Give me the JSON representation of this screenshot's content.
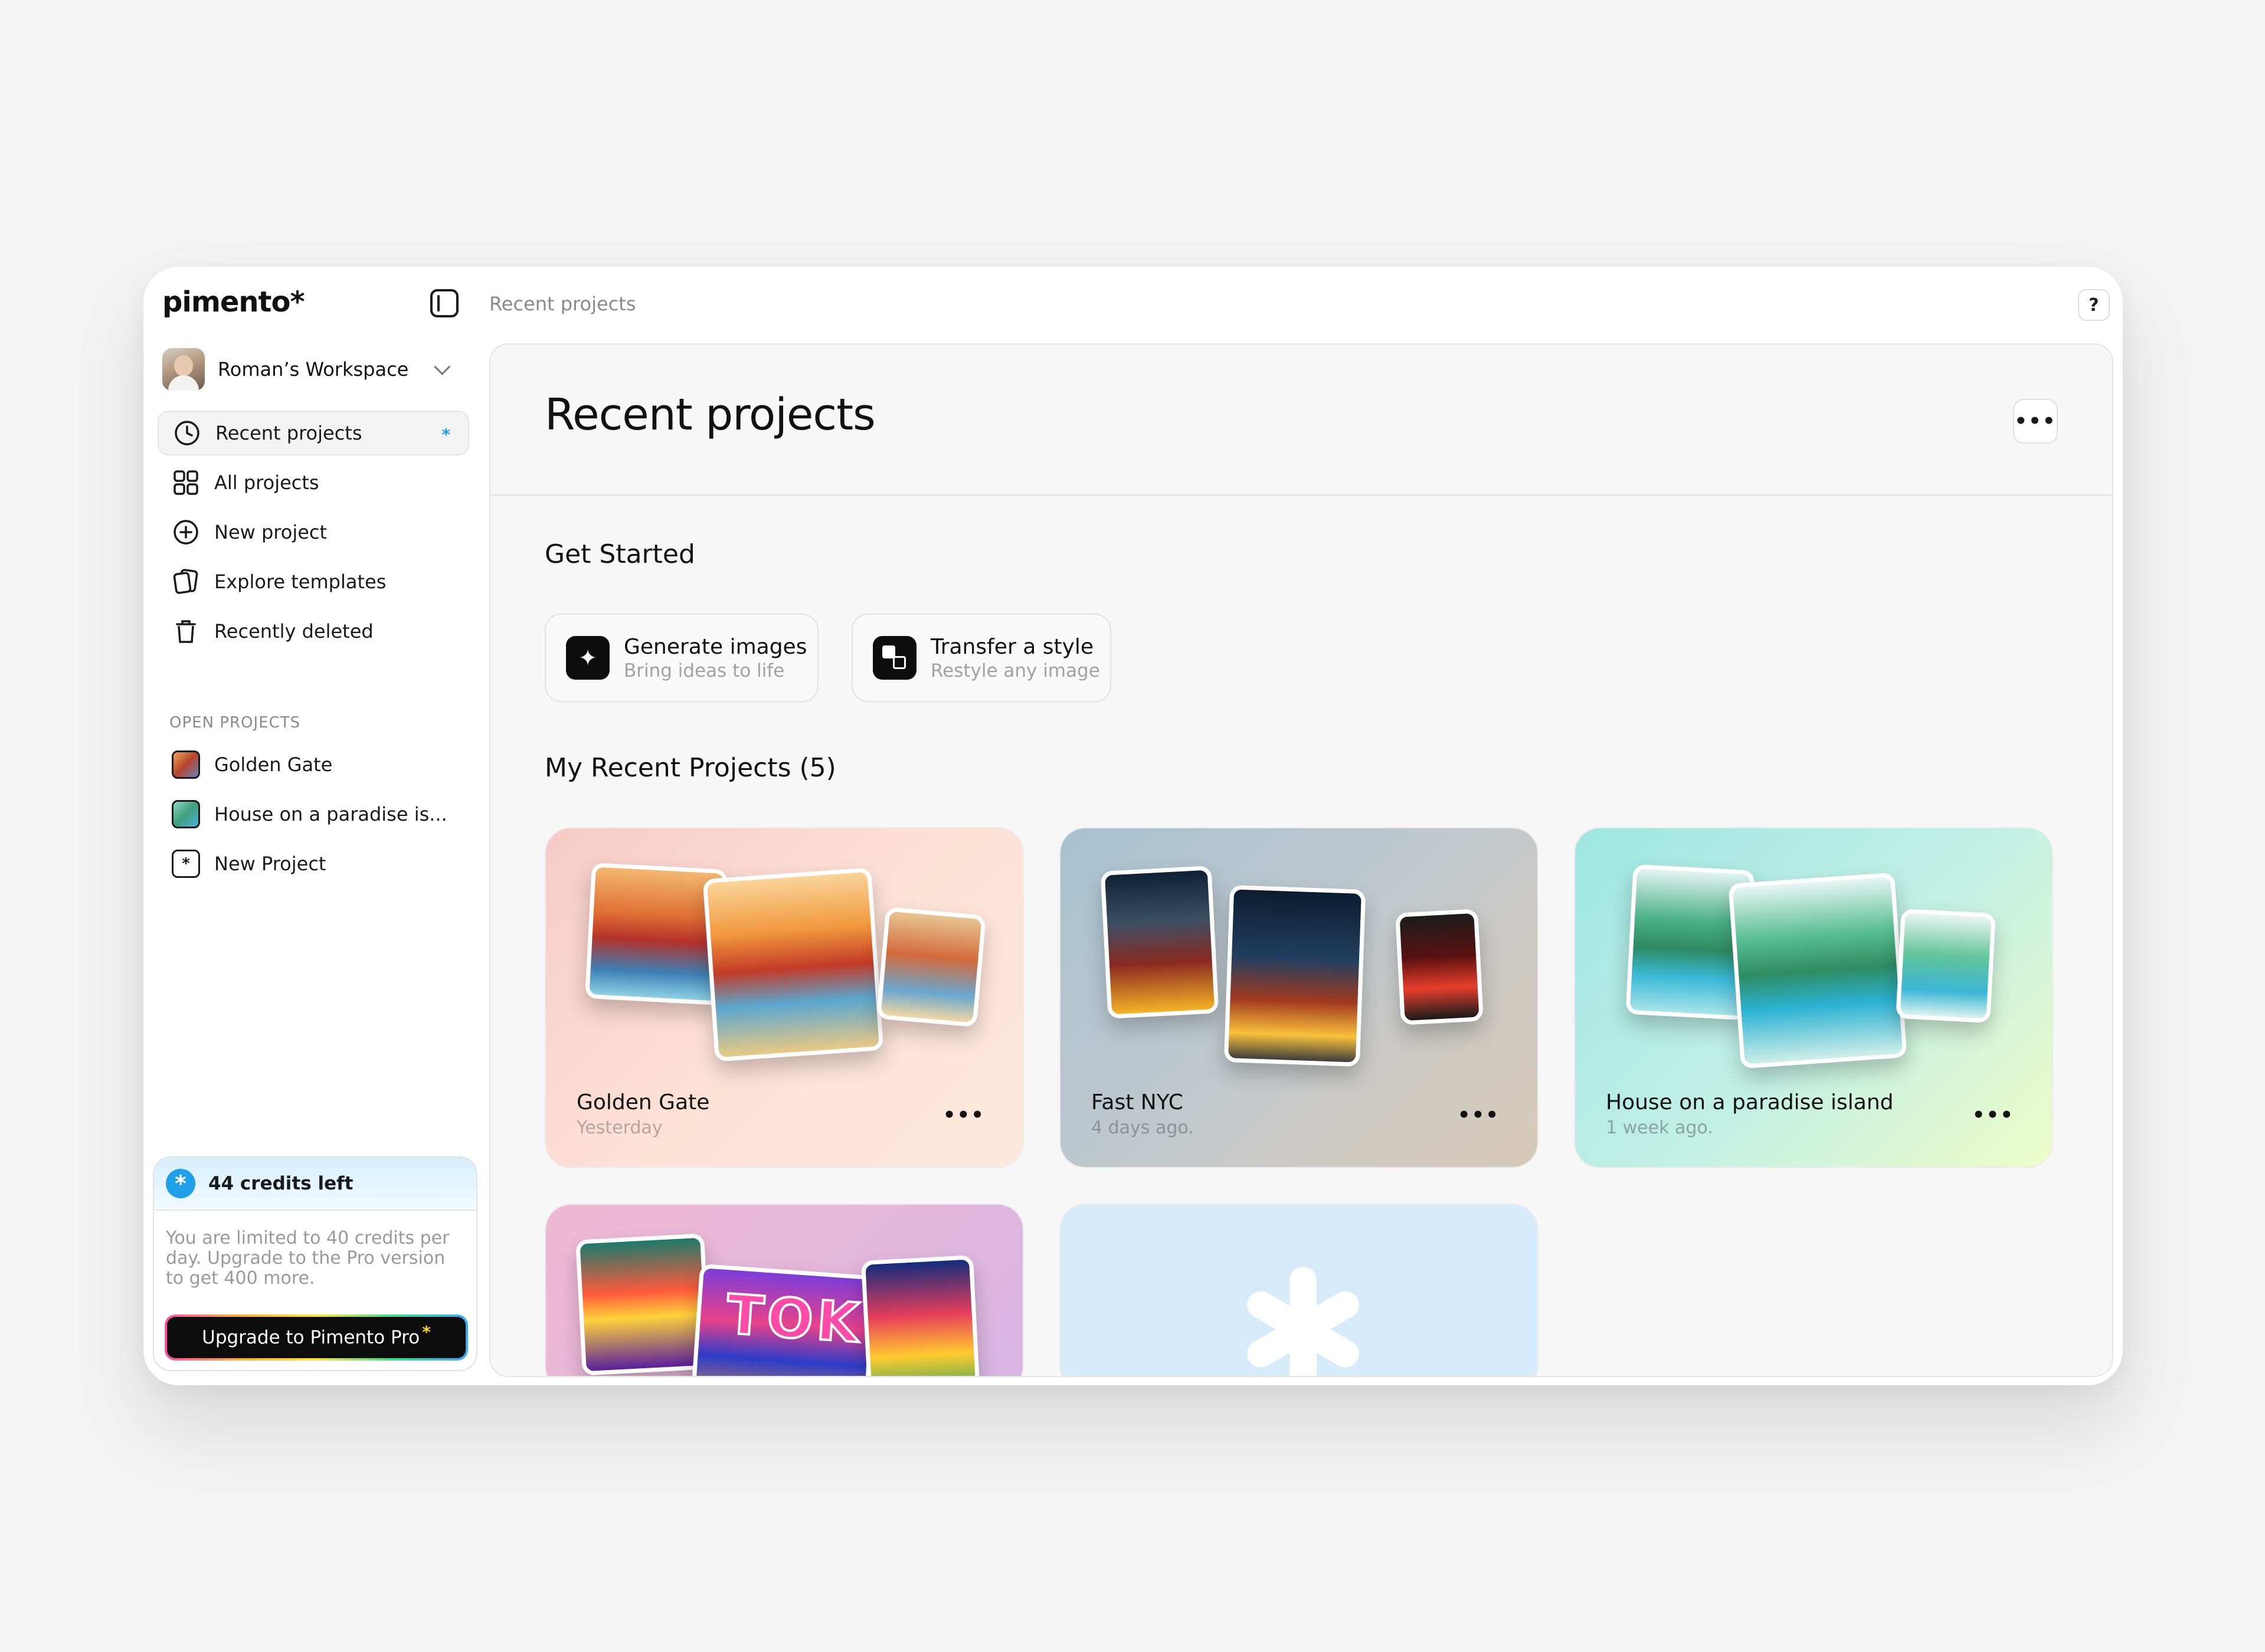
{
  "app": {
    "logo": "pimento*",
    "breadcrumb": "Recent projects",
    "help_label": "?"
  },
  "workspace": {
    "name": "Roman’s Workspace"
  },
  "sidebar": {
    "items": [
      {
        "label": "Recent projects",
        "icon": "clock-icon",
        "active": true,
        "badge": "*"
      },
      {
        "label": "All projects",
        "icon": "grid-icon"
      },
      {
        "label": "New project",
        "icon": "plus-circle-icon"
      },
      {
        "label": "Explore templates",
        "icon": "templates-icon"
      },
      {
        "label": "Recently deleted",
        "icon": "trash-icon"
      }
    ],
    "open_projects_label": "OPEN PROJECTS",
    "open_projects": [
      {
        "label": "Golden Gate",
        "thumb": "golden-gate"
      },
      {
        "label": "House on a paradise is...",
        "thumb": "paradise"
      },
      {
        "label": "New Project",
        "thumb": "asterisk",
        "thumb_glyph": "*"
      }
    ]
  },
  "credits": {
    "star": "*",
    "title": "44 credits left",
    "text": "You are limited to 40 credits per day. Upgrade to the Pro version to get 400 more.",
    "upgrade_label": "Upgrade to Pimento Pro",
    "upgrade_star": "*",
    "brand_color": "#1fa0e8"
  },
  "main": {
    "title": "Recent projects",
    "more_label": "•••",
    "get_started_title": "Get Started",
    "actions": [
      {
        "title": "Generate images",
        "subtitle": "Bring ideas to life",
        "icon": "sparkle-icon",
        "glyph": "✦"
      },
      {
        "title": "Transfer a style",
        "subtitle": "Restyle any image",
        "icon": "style-transfer-icon"
      }
    ],
    "recent_title": "My Recent Projects (5)",
    "projects": [
      {
        "name": "Golden Gate",
        "date": "Yesterday",
        "more": "•••"
      },
      {
        "name": "Fast NYC",
        "date": "4 days ago.",
        "more": "•••"
      },
      {
        "name": "House on a paradise island",
        "date": "1 week ago.",
        "more": "•••"
      },
      {
        "name": "",
        "date": "",
        "thumb_text": "TOK"
      },
      {
        "name": "",
        "date": "",
        "placeholder_icon": "asterisk-icon"
      }
    ]
  }
}
